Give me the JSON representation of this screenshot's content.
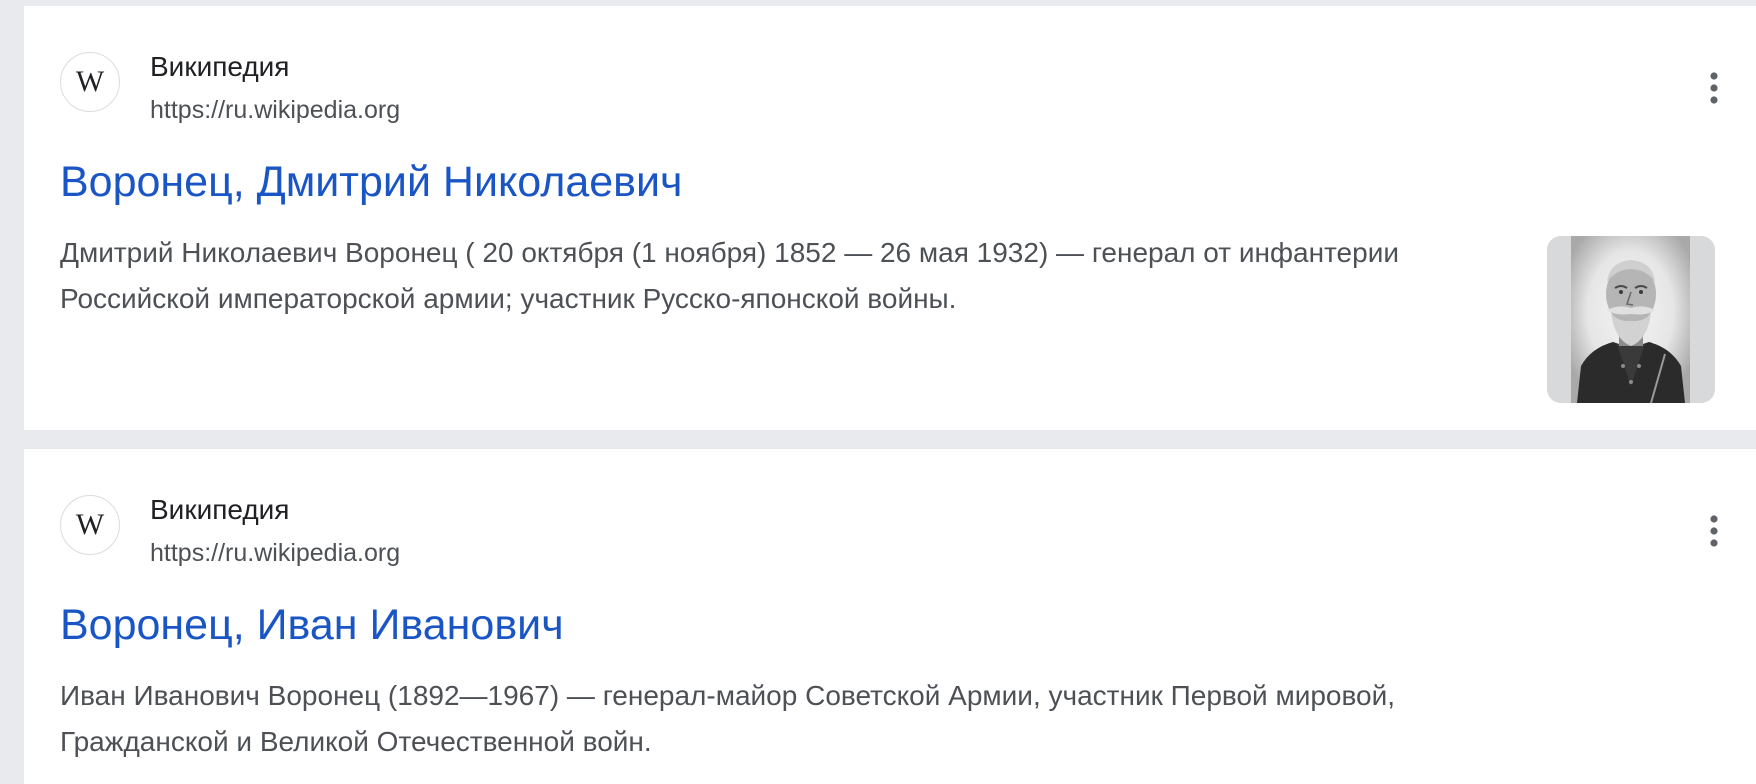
{
  "results": [
    {
      "site_name": "Википедия",
      "site_url": "https://ru.wikipedia.org",
      "favicon_icon": "wikipedia-w-icon",
      "favicon_letter": "W",
      "title": "Воронец, Дмитрий Николаевич",
      "snippet": "Дмитрий Николаевич Воронец ( 20 октября (1 ноября) 1852 — 26 мая 1932) — генерал от инфантерии Российской императорской армии; участник Русско-японской войны.",
      "thumbnail": "portrait-photo",
      "menu_icon": "more-vert-icon"
    },
    {
      "site_name": "Википедия",
      "site_url": "https://ru.wikipedia.org",
      "favicon_icon": "wikipedia-w-icon",
      "favicon_letter": "W",
      "title": "Воронец, Иван Иванович",
      "snippet": "Иван Иванович Воронец (1892—1967) — генерал-майор Советской Армии, участник Первой мировой, Гражданской и Великой Отечественной войн.",
      "menu_icon": "more-vert-icon"
    }
  ],
  "colors": {
    "page_background": "#e8eaed",
    "card_background": "#ffffff",
    "title_link": "#1a55c6",
    "text_secondary": "#4d5156",
    "text_primary": "#202124"
  }
}
